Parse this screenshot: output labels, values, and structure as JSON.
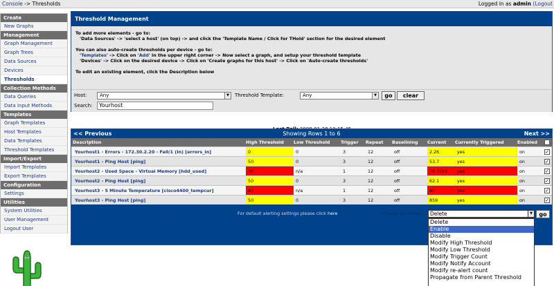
{
  "topbar": {
    "console": "Console",
    "arrow": " -> ",
    "page": "Thresholds",
    "logged_prefix": "Logged in as ",
    "user": "admin",
    "logout": "(Logout"
  },
  "sidebar": {
    "sections": [
      {
        "title": "Create",
        "items": [
          "New Graphs"
        ]
      },
      {
        "title": "Management",
        "items": [
          "Graph Management",
          "Graph Trees",
          "Data Sources",
          "Devices",
          "Thresholds"
        ]
      },
      {
        "title": "Collection Methods",
        "items": [
          "Data Queries",
          "Data Input Methods"
        ]
      },
      {
        "title": "Templates",
        "items": [
          "Graph Templates",
          "Host Templates",
          "Data Templates",
          "Threshold Templates"
        ]
      },
      {
        "title": "Import/Export",
        "items": [
          "Import Templates",
          "Export Templates"
        ]
      },
      {
        "title": "Configuration",
        "items": [
          "Settings"
        ]
      },
      {
        "title": "Utilities",
        "items": [
          "System Utilities",
          "User Management",
          "Logout User"
        ]
      }
    ],
    "active": "Thresholds"
  },
  "panel": {
    "title": "Threshold Management",
    "line1": "To add more elements - go to:",
    "line2": "'Data Sources' -> 'select a host' (on top) -> and click the 'Template Name / Click for THold' section for the desired element",
    "line3": "You can also auto-create thresholds per device - go to:",
    "line4a": "'",
    "line4_link1": "Templates",
    "line4b": "' -> Click on '",
    "line4_link2": "Add",
    "line4c": "' in the upper right corner -> Now select a graph, and setup your threshold template",
    "line5": "'Devices' -> Click on the desired device -> Click on 'Create graphs for this host' -> Click on 'Auto-create thresholds'",
    "line6": "To edit an existing element, click the Description below",
    "host_label": "Host:",
    "host_value": "Any",
    "template_label": "Threshold Template:",
    "template_value": "Any",
    "go": "go",
    "clear": "clear",
    "search_label": "Search:",
    "search_value": "Yourhost"
  },
  "last_poll": {
    "label": "Last Poll:",
    "value": "2008-01-28 10:15:45"
  },
  "results": {
    "prev": "<< Previous",
    "showing": "Showing Rows 1 to 6",
    "next": "Next >>",
    "headers": [
      "Description",
      "High Threshold",
      "Low Threshold",
      "Trigger",
      "Repeat",
      "Baselining",
      "Current",
      "Currently Triggered",
      "Enabled"
    ],
    "rows": [
      {
        "desc": "Yourhost1 - Errors - 172.30.2.20 - Fa0/1 (In) [errors_in]",
        "high": "0",
        "low": "0",
        "trigger": "3",
        "repeat": "12",
        "baseline": "off",
        "current": "2.26",
        "triggered": "yes",
        "enabled": "on",
        "status": "#ffff00"
      },
      {
        "desc": "Yourhost1 - Ping Host [ping]",
        "high": "50",
        "low": "0",
        "trigger": "3",
        "repeat": "12",
        "baseline": "off",
        "current": "53.7",
        "triggered": "yes",
        "enabled": "on",
        "status": "#ffff00"
      },
      {
        "desc": "Yourhost2 - Used Space - Virtual Memory [hdd_used]",
        "high": "20",
        "low": "n/a",
        "trigger": "1",
        "repeat": "12",
        "baseline": "off",
        "current": "76.7381",
        "triggered": "yes",
        "enabled": "on",
        "status": "#ff0000"
      },
      {
        "desc": "Yourhost2 - Ping Host [ping]",
        "high": "50",
        "low": "0",
        "trigger": "3",
        "repeat": "12",
        "baseline": "off",
        "current": "62.1",
        "triggered": "yes",
        "enabled": "on",
        "status": "#ffff00"
      },
      {
        "desc": "Yourhost3 - 5 Minute Temperature [cisco4400_tempcur]",
        "high": "45",
        "low": "n/a",
        "trigger": "1",
        "repeat": "12",
        "baseline": "off",
        "current": "46",
        "triggered": "yes",
        "enabled": "on",
        "status": "#ff0000"
      },
      {
        "desc": "Yourhost3 - Ping Host [ping]",
        "high": "50",
        "low": "0",
        "trigger": "3",
        "repeat": "12",
        "baseline": "off",
        "current": "859",
        "triggered": "yes",
        "enabled": "on",
        "status": "#ffff00"
      }
    ],
    "default_text": "For default alerting settings please click ",
    "default_link": "here",
    "choose_action": "Choose an action:"
  },
  "actions": {
    "selected": "Delete",
    "go": "go",
    "options": [
      "Delete",
      "Enable",
      "Disable",
      "Modify High Threshold",
      "Modify Low Threshold",
      "Modify Trigger Count",
      "Modify Notify Account",
      "Modify re-alert count",
      "Propagate from Parent Threshold"
    ],
    "highlighted_index": 1
  },
  "colors": {
    "header_blue": "#00438c",
    "sidebar_head": "#6d6d6d",
    "link": "#1c3a88",
    "alert_yellow": "#ffff00",
    "alert_red": "#ff0000"
  }
}
